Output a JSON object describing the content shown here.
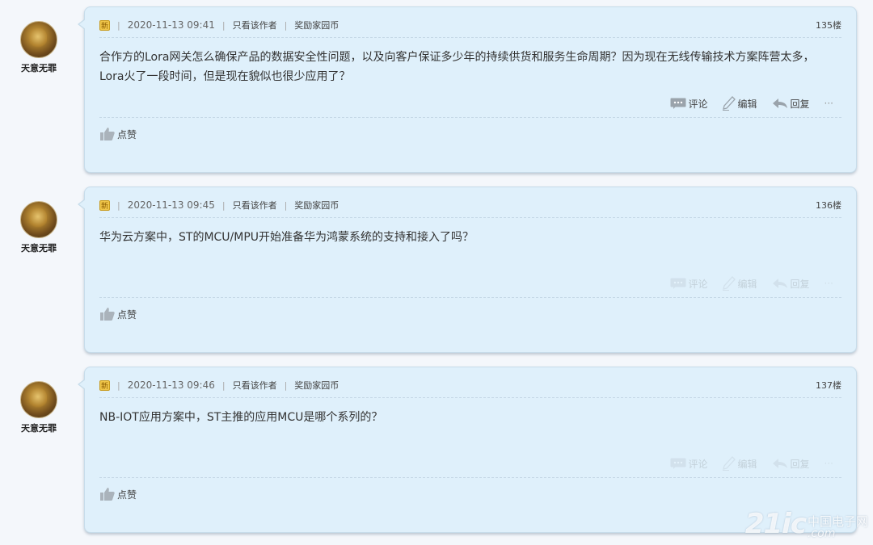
{
  "posts": [
    {
      "username": "天意无罪",
      "badge": "新",
      "timestamp": "2020-11-13 09:41",
      "only_author": "只看该作者",
      "reward": "奖励家园币",
      "floor": "135楼",
      "content": "合作方的Lora网关怎么确保产品的数据安全性问题，以及向客户保证多少年的持续供货和服务生命周期？因为现在无线传输技术方案阵营太多，Lora火了一段时间，但是现在貌似也很少应用了？",
      "actions": {
        "comment": "评论",
        "edit": "编辑",
        "reply": "回复",
        "more": "···"
      },
      "like": "点赞",
      "actions_faded": false
    },
    {
      "username": "天意无罪",
      "badge": "新",
      "timestamp": "2020-11-13 09:45",
      "only_author": "只看该作者",
      "reward": "奖励家园币",
      "floor": "136楼",
      "content": "华为云方案中，ST的MCU/MPU开始准备华为鸿蒙系统的支持和接入了吗？",
      "actions": {
        "comment": "评论",
        "edit": "编辑",
        "reply": "回复",
        "more": "···"
      },
      "like": "点赞",
      "actions_faded": true
    },
    {
      "username": "天意无罪",
      "badge": "新",
      "timestamp": "2020-11-13 09:46",
      "only_author": "只看该作者",
      "reward": "奖励家园币",
      "floor": "137楼",
      "content": "NB-IOT应用方案中，ST主推的应用MCU是哪个系列的？",
      "actions": {
        "comment": "评论",
        "edit": "编辑",
        "reply": "回复",
        "more": "···"
      },
      "like": "点赞",
      "actions_faded": true
    }
  ],
  "watermark": {
    "logo": "21ic",
    "cn": "中国电子网",
    "en": ".com"
  },
  "colors": {
    "page_bg": "#f4f7fb",
    "card_bg": "#dff0fb",
    "card_border": "#c7dcea",
    "badge": "#f0c64a"
  }
}
